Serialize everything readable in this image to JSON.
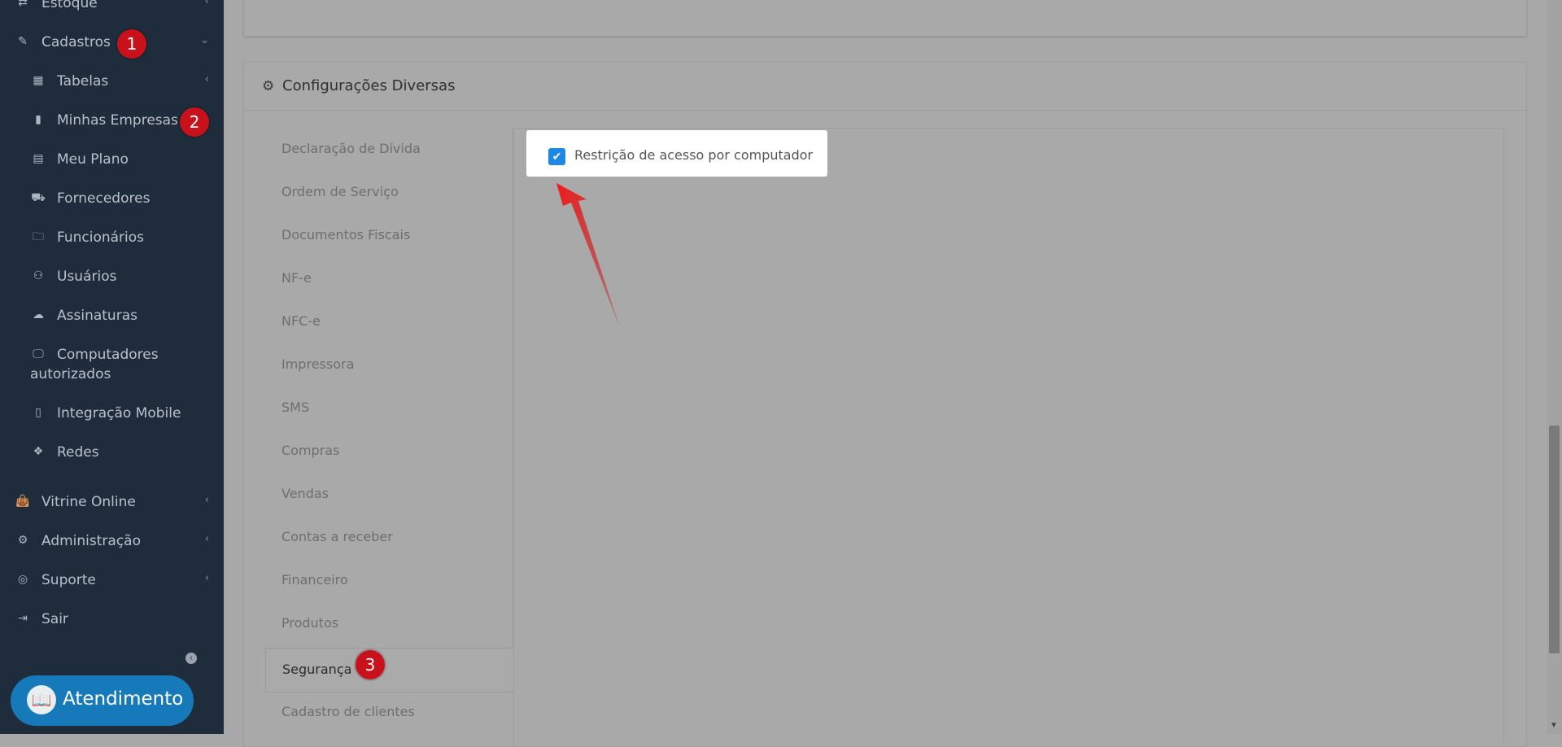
{
  "sidebar": {
    "items": [
      {
        "label": "Estoque",
        "icon": "exchange-icon"
      },
      {
        "label": "Cadastros",
        "icon": "edit-icon"
      },
      {
        "label": "Tabelas",
        "icon": "table-icon"
      },
      {
        "label": "Minhas Empresas",
        "icon": "building-icon"
      },
      {
        "label": "Meu Plano",
        "icon": "document-icon"
      },
      {
        "label": "Fornecedores",
        "icon": "truck-icon"
      },
      {
        "label": "Funcionários",
        "icon": "folder-icon"
      },
      {
        "label": "Usuários",
        "icon": "users-icon"
      },
      {
        "label": "Assinaturas",
        "icon": "cloud-icon"
      },
      {
        "label": "Computadores",
        "label2": "autorizados",
        "icon": "desktop-icon"
      },
      {
        "label": "Integração Mobile",
        "icon": "mobile-icon"
      },
      {
        "label": "Redes",
        "icon": "cubes-icon"
      },
      {
        "label": "Vitrine Online",
        "icon": "shopping-bag-icon"
      },
      {
        "label": "Administração",
        "icon": "cogs-icon"
      },
      {
        "label": "Suporte",
        "icon": "life-ring-icon"
      },
      {
        "label": "Sair",
        "icon": "sign-out-icon"
      }
    ],
    "atendimento_label": "Atendimento"
  },
  "badges": [
    "1",
    "2",
    "3"
  ],
  "config": {
    "title": "Configurações Diversas",
    "tabs": [
      "Declaração de Dívida",
      "Ordem de Serviço",
      "Documentos Fiscais",
      "NF-e",
      "NFC-e",
      "Impressora",
      "SMS",
      "Compras",
      "Vendas",
      "Contas a receber",
      "Financeiro",
      "Produtos",
      "Segurança",
      "Cadastro de clientes"
    ],
    "active_tab": "Segurança",
    "checkbox_label": "Restrição de acesso por computador",
    "checkbox_checked": true
  },
  "colors": {
    "sidebar_bg": "#1f2c3b",
    "badge_red": "#c8111b",
    "checkbox_blue": "#1e88e5",
    "atendimento_blue": "#1679b9",
    "arrow_red": "#e01818"
  }
}
